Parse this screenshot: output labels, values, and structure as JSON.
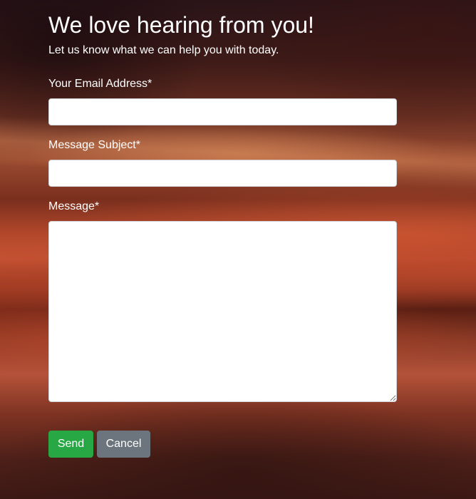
{
  "header": {
    "title": "We love hearing from you!",
    "subtitle": "Let us know what we can help you with today."
  },
  "form": {
    "email": {
      "label": "Your Email Address*",
      "value": "",
      "placeholder": ""
    },
    "subject": {
      "label": "Message Subject*",
      "value": "",
      "placeholder": ""
    },
    "message": {
      "label": "Message*",
      "value": "",
      "placeholder": ""
    }
  },
  "actions": {
    "send_label": "Send",
    "cancel_label": "Cancel"
  },
  "colors": {
    "send_button": "#28a745",
    "cancel_button": "#6c757d",
    "text": "#ffffff"
  }
}
